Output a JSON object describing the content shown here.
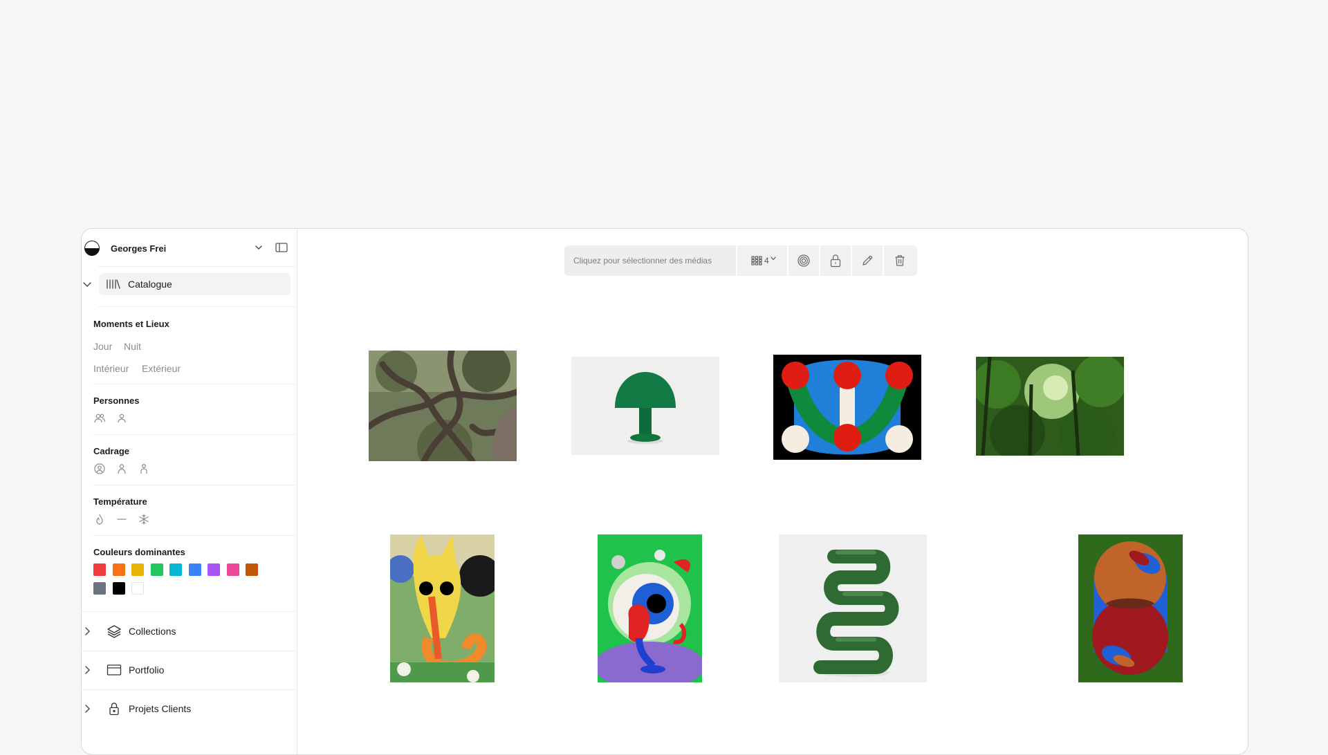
{
  "sidebar": {
    "user_name": "Georges Frei",
    "catalogue_label": "Catalogue",
    "moments": {
      "title": "Moments et Lieux",
      "tags": [
        "Jour",
        "Nuit",
        "Intérieur",
        "Extérieur"
      ]
    },
    "persons": {
      "title": "Personnes",
      "icons": [
        "group-icon",
        "person-icon"
      ]
    },
    "framing": {
      "title": "Cadrage",
      "icons": [
        "face-circle-icon",
        "person-bust-icon",
        "person-full-icon"
      ]
    },
    "temperature": {
      "title": "Température",
      "icons": [
        "flame-icon",
        "neutral-dash-icon",
        "snowflake-icon"
      ]
    },
    "colors": {
      "title": "Couleurs dominantes",
      "swatches": [
        "#ef3b3b",
        "#f97316",
        "#eab308",
        "#22c55e",
        "#06b6d4",
        "#3b82f6",
        "#a855f7",
        "#ec4899",
        "#c2570c",
        "#6b7280",
        "#000000",
        "#ffffff"
      ]
    },
    "nav": [
      {
        "label": "Collections",
        "icon": "layers-icon"
      },
      {
        "label": "Portfolio",
        "icon": "browser-window-icon"
      },
      {
        "label": "Projets Clients",
        "icon": "lock-icon"
      }
    ]
  },
  "toolbar": {
    "search_placeholder": "Cliquez pour sélectionner des médias",
    "grid_columns": "4",
    "buttons": [
      "fingerprint-icon",
      "lock-icon",
      "pencil-icon",
      "trash-icon"
    ]
  },
  "gallery": [
    {
      "subject": "twisted-tree"
    },
    {
      "subject": "green-lamp"
    },
    {
      "subject": "abstract-circles"
    },
    {
      "subject": "forest"
    },
    {
      "subject": "yellow-creature-painting"
    },
    {
      "subject": "eyeball-illustration"
    },
    {
      "subject": "green-ribbon-sculpture"
    },
    {
      "subject": "abstract-ovals"
    }
  ]
}
